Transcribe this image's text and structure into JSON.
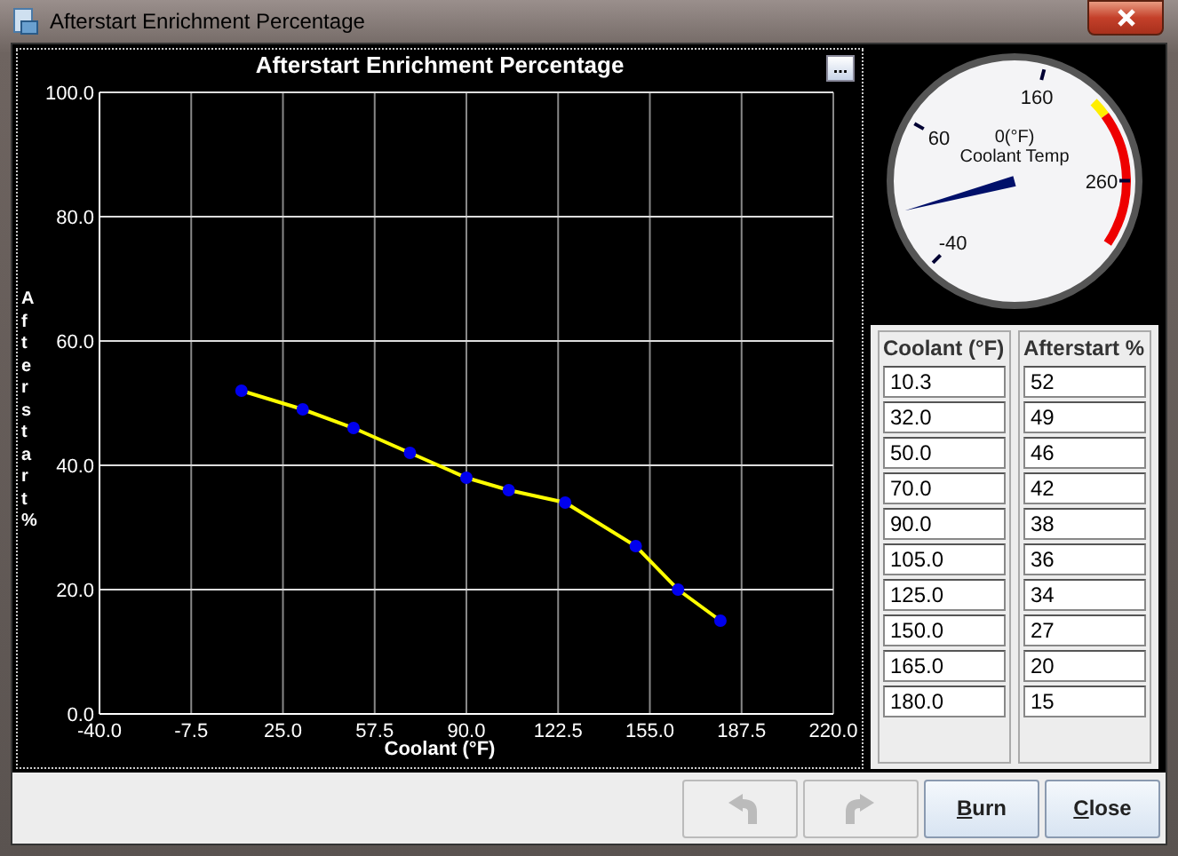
{
  "window": {
    "title": "Afterstart Enrichment Percentage"
  },
  "chart": {
    "menu_button": "...",
    "chart_data": {
      "type": "line",
      "title": "Afterstart Enrichment Percentage",
      "xlabel": "Coolant (°F)",
      "ylabel": "Afterstart %",
      "x": [
        10.3,
        32.0,
        50.0,
        70.0,
        90.0,
        105.0,
        125.0,
        150.0,
        165.0,
        180.0
      ],
      "grid": true,
      "series": [
        {
          "color": "#ffff00",
          "marker": "circle",
          "values": [
            52,
            49,
            46,
            42,
            38,
            36,
            34,
            27,
            20,
            15
          ]
        }
      ],
      "xlim": [
        -40,
        220
      ],
      "ylim": [
        0,
        100
      ],
      "xticks": [
        {
          "value": -40,
          "label": "-40.0"
        },
        {
          "value": -7.5,
          "label": "-7.5"
        },
        {
          "value": 25,
          "label": "25.0"
        },
        {
          "value": 57.5,
          "label": "57.5"
        },
        {
          "value": 90,
          "label": "90.0"
        },
        {
          "value": 122.5,
          "label": "122.5"
        },
        {
          "value": 155,
          "label": "155.0"
        },
        {
          "value": 187.5,
          "label": "187.5"
        },
        {
          "value": 220,
          "label": "220.0"
        }
      ],
      "yticks": [
        {
          "value": 0,
          "label": "0.0"
        },
        {
          "value": 20,
          "label": "20.0"
        },
        {
          "value": 40,
          "label": "40.0"
        },
        {
          "value": 60,
          "label": "60.0"
        },
        {
          "value": 80,
          "label": "80.0"
        },
        {
          "value": 100,
          "label": "100.0"
        }
      ]
    }
  },
  "gauge": {
    "reading": "0(°F)",
    "label": "Coolant Temp",
    "level": 0.133,
    "ticks": [
      "-40",
      "60",
      "160",
      "260"
    ]
  },
  "table": {
    "columns": [
      "Coolant (°F)",
      "Afterstart %"
    ],
    "rows": [
      [
        "10.3",
        "52"
      ],
      [
        "32.0",
        "49"
      ],
      [
        "50.0",
        "46"
      ],
      [
        "70.0",
        "42"
      ],
      [
        "90.0",
        "38"
      ],
      [
        "105.0",
        "36"
      ],
      [
        "125.0",
        "34"
      ],
      [
        "150.0",
        "27"
      ],
      [
        "165.0",
        "20"
      ],
      [
        "180.0",
        "15"
      ]
    ]
  },
  "buttons": [
    {
      "kind": "undo",
      "disabled": true
    },
    {
      "kind": "redo",
      "disabled": true
    },
    {
      "kind": "text",
      "label": "Burn",
      "mnemonic": true,
      "disabled": false
    },
    {
      "kind": "text",
      "label": "Close",
      "mnemonic": true,
      "disabled": false
    }
  ]
}
